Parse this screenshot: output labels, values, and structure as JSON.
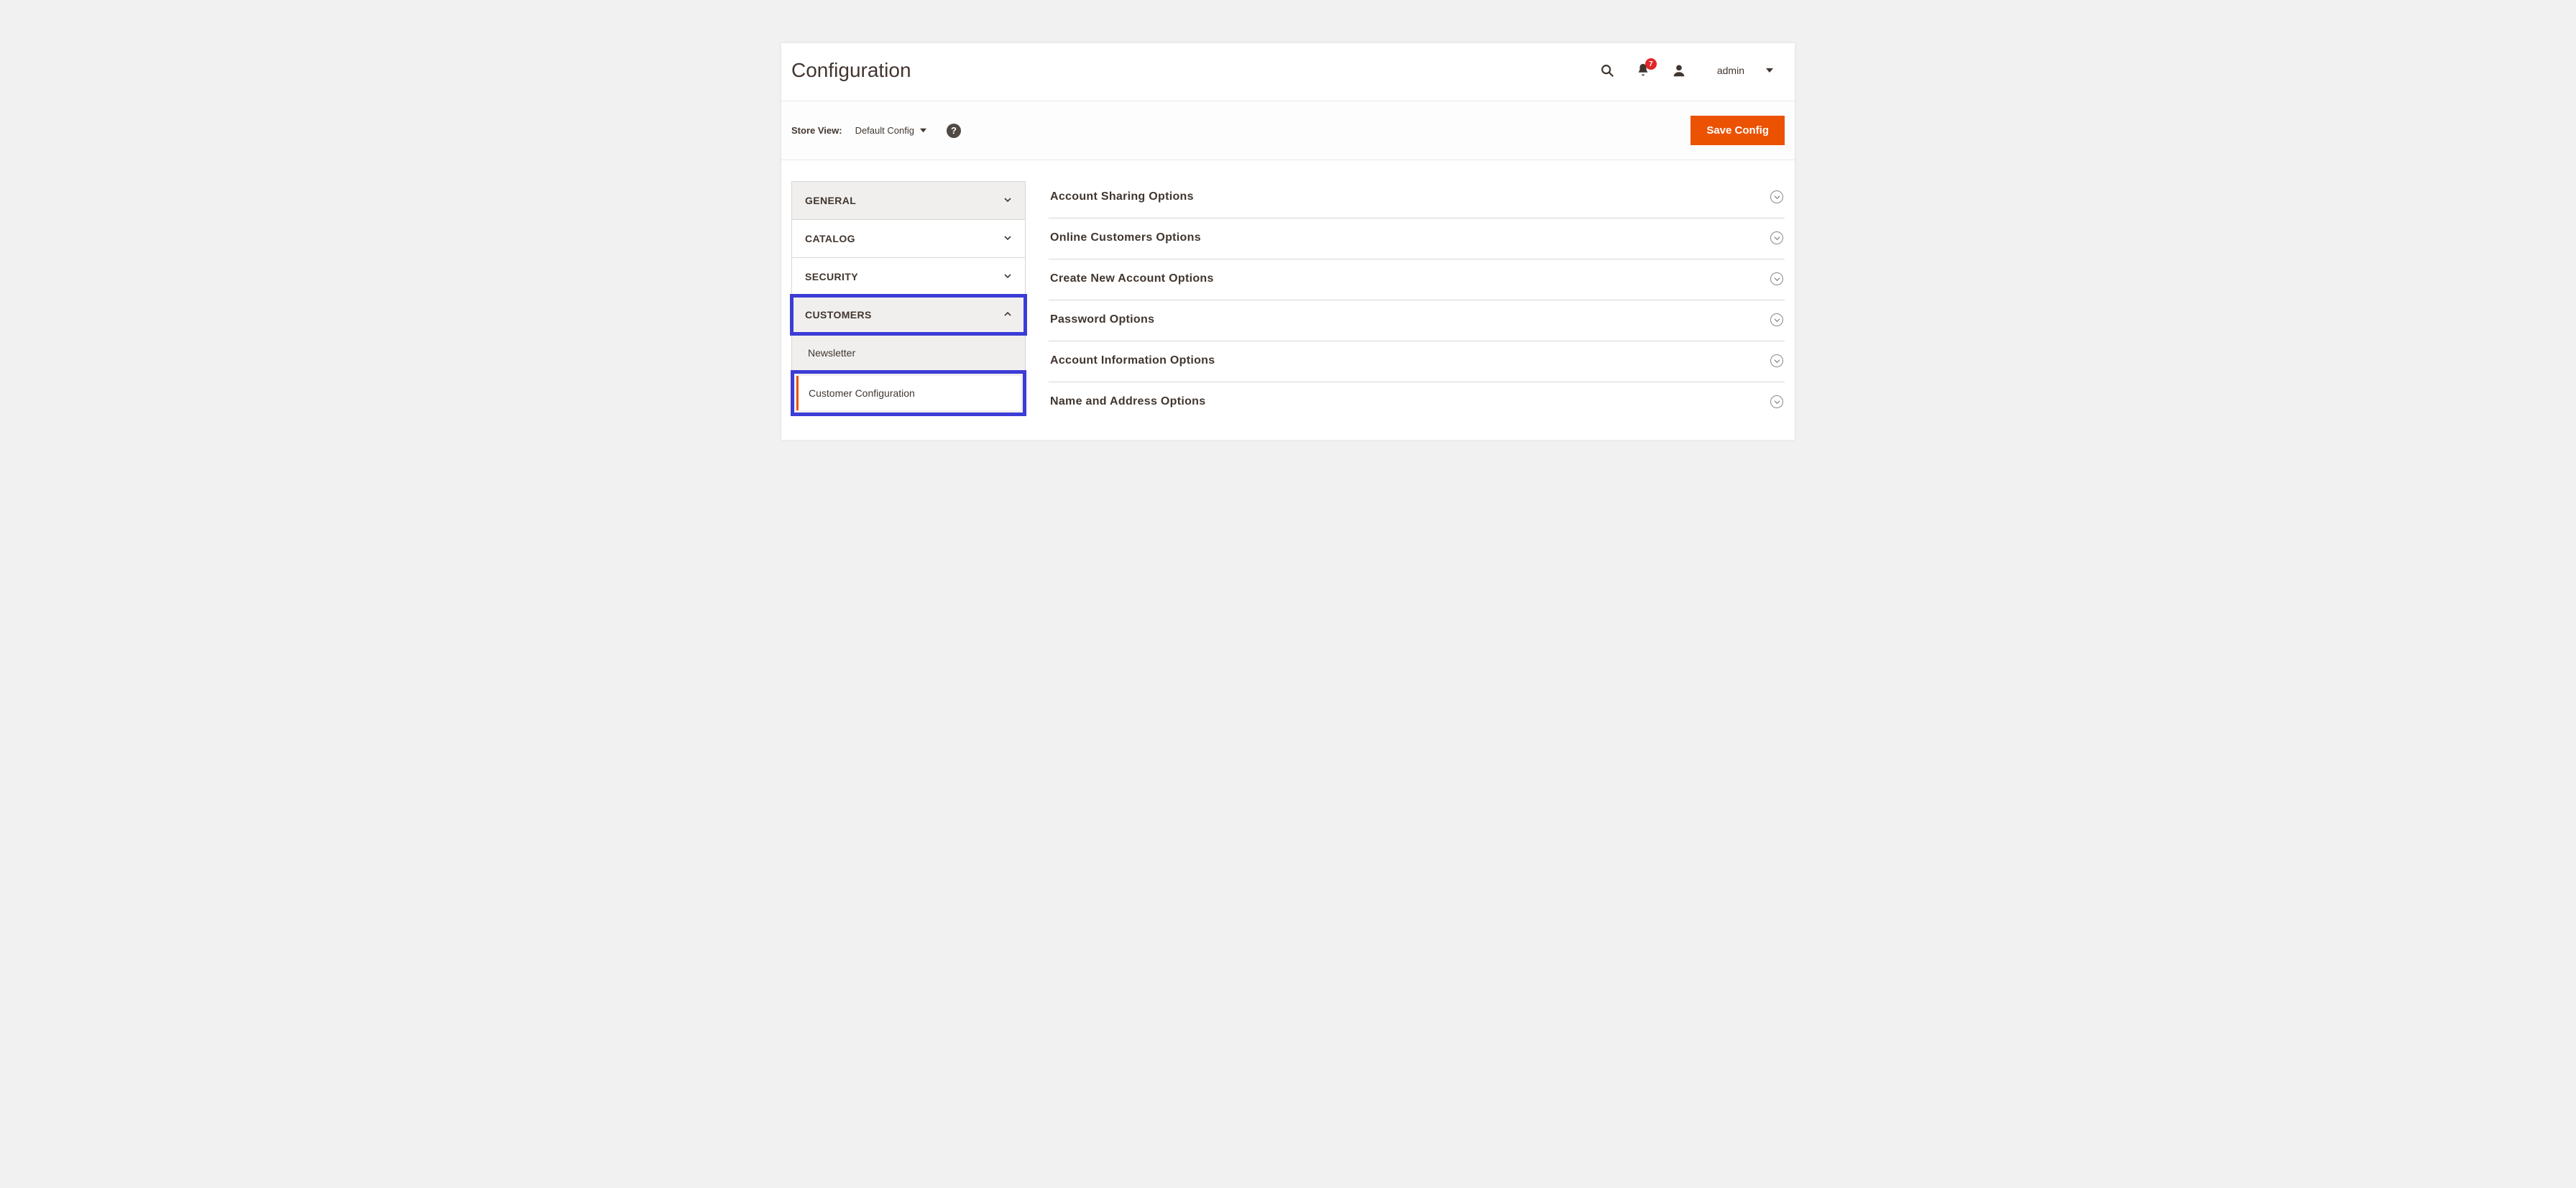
{
  "header": {
    "title": "Configuration",
    "notification_count": "7",
    "username": "admin"
  },
  "toolbar": {
    "store_view_label": "Store View:",
    "store_view_value": "Default Config",
    "help_icon": "?",
    "save_label": "Save Config"
  },
  "sidebar": {
    "tabs": [
      {
        "label": "GENERAL",
        "expanded": false,
        "bg": "gray",
        "highlight": false
      },
      {
        "label": "CATALOG",
        "expanded": false,
        "bg": "white",
        "highlight": false
      },
      {
        "label": "SECURITY",
        "expanded": false,
        "bg": "white",
        "highlight": false
      },
      {
        "label": "CUSTOMERS",
        "expanded": true,
        "bg": "gray",
        "highlight": true
      }
    ],
    "customers_children": [
      {
        "label": "Newsletter",
        "active": false
      },
      {
        "label": "Customer Configuration",
        "active": true
      }
    ]
  },
  "sections": [
    {
      "title": "Account Sharing Options"
    },
    {
      "title": "Online Customers Options"
    },
    {
      "title": "Create New Account Options"
    },
    {
      "title": "Password Options"
    },
    {
      "title": "Account Information Options"
    },
    {
      "title": "Name and Address Options"
    }
  ]
}
